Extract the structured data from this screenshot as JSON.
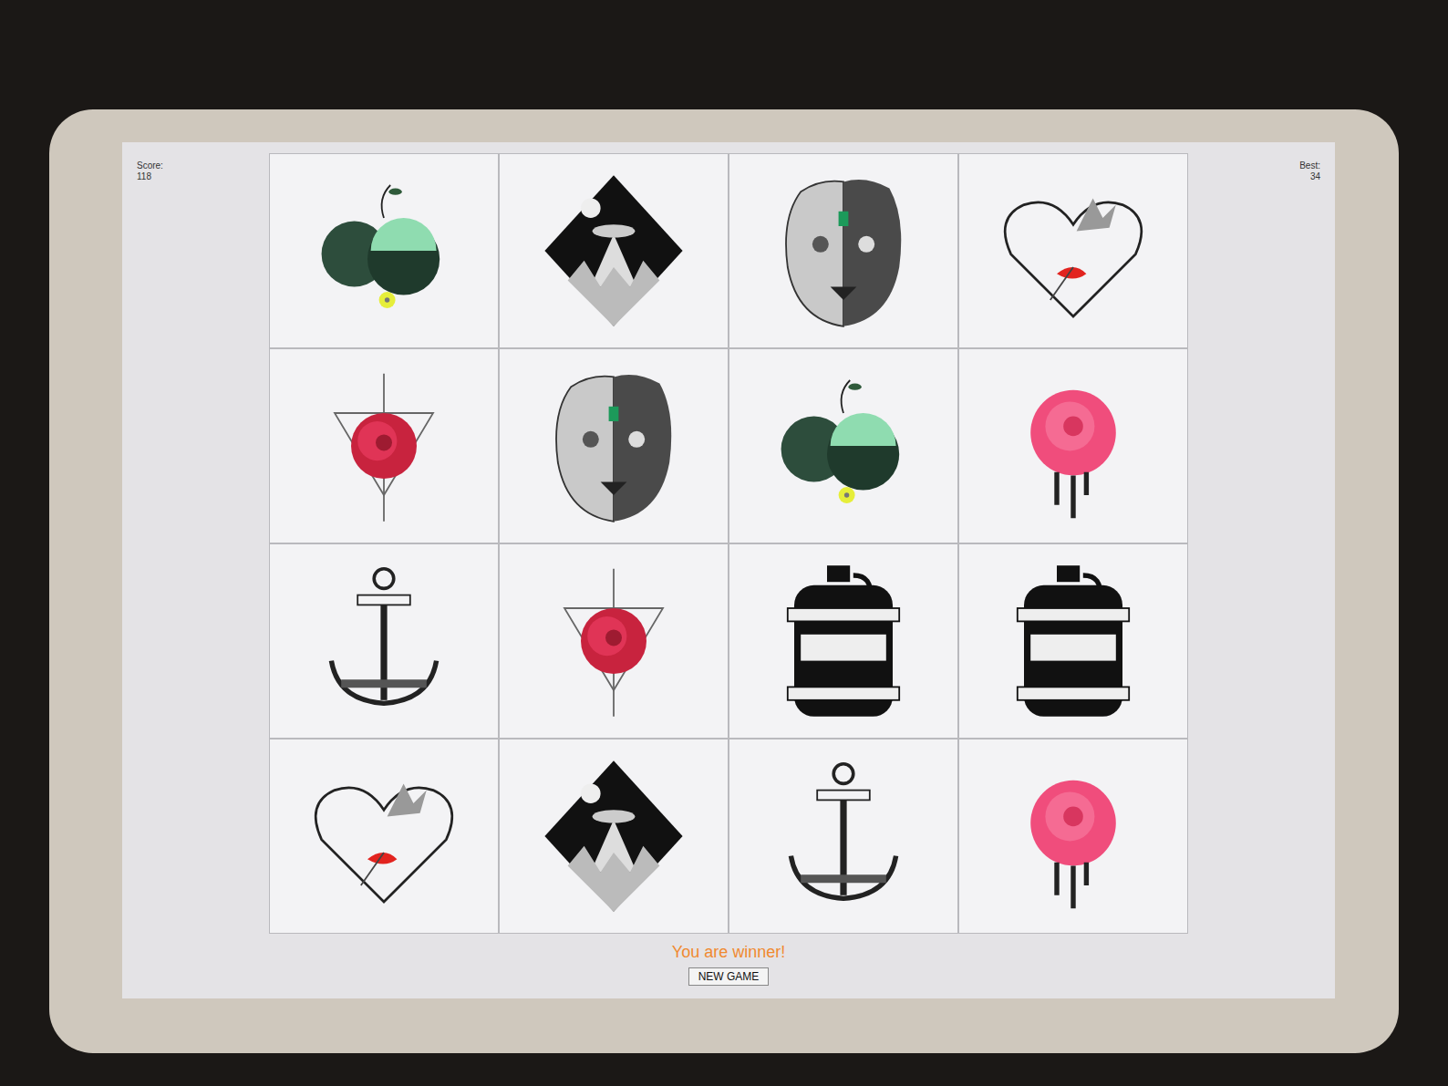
{
  "score": {
    "label": "Score:",
    "value": "118"
  },
  "best": {
    "label": "Best:",
    "value": "34"
  },
  "cards": [
    {
      "kind": "hate",
      "revealed": true
    },
    {
      "kind": "ufo",
      "revealed": true
    },
    {
      "kind": "lion",
      "revealed": true
    },
    {
      "kind": "heart",
      "revealed": true
    },
    {
      "kind": "rosegeo",
      "revealed": true
    },
    {
      "kind": "lion",
      "revealed": true
    },
    {
      "kind": "hate",
      "revealed": true
    },
    {
      "kind": "rosedrip",
      "revealed": true
    },
    {
      "kind": "anchor",
      "revealed": true
    },
    {
      "kind": "rosegeo",
      "revealed": true
    },
    {
      "kind": "whiskey",
      "revealed": true
    },
    {
      "kind": "whiskey",
      "revealed": true
    },
    {
      "kind": "heart",
      "revealed": true
    },
    {
      "kind": "ufo",
      "revealed": true
    },
    {
      "kind": "anchor",
      "revealed": true
    },
    {
      "kind": "rosedrip",
      "revealed": true
    }
  ],
  "message": "You are winner!",
  "buttons": [
    "NEW GAME"
  ]
}
